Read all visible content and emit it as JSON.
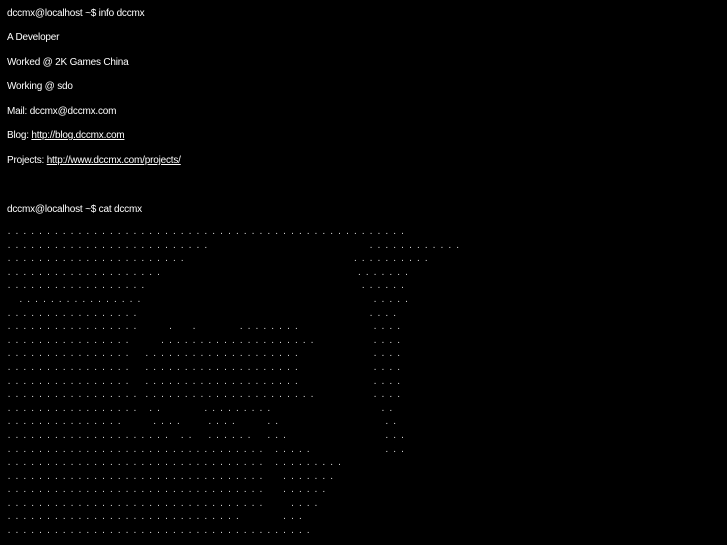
{
  "terminal": {
    "prompt1": "dccmx@localhost ~$ info dccmx",
    "info": {
      "role": "A Developer",
      "worked": "Worked @ 2K Games China",
      "working": "Working @ sdo",
      "mail": "Mail: dccmx@dccmx.com",
      "blog_label": "Blog: ",
      "blog_link": "http://blog.dccmx.com",
      "projects_label": "Projects: ",
      "projects_link": "http://www.dccmx.com/projects/"
    },
    "prompt2": "dccmx@localhost ~$ cat dccmx",
    "ascii_art": [
      ". . . . . . . . . . . . . . . . . . . . . . . . . . . . . . . . . . . . . . . . . . . . . . . . . . .",
      ". . . . . . . . . . . . . . . . . . . . . . . . . .                                         . . . . . . . . . . . .",
      ". . . . . . . . . . . . . . . . . . . . . . .                                           . . . . . . . . . .",
      ". . . . . . . . . . . . . . . . . . . .                                                  . . . . . . .",
      ". . . . . . . . . . . . . . . . . .                                                       . . . . . .",
      "   . . . . . . . . . . . . . . . .                                                           . . . . .",
      ". . . . . . . . . . . . . . . . .                                                           . . . .",
      ". . . . . . . . . . . . . . . . .        .     .           . . . . . . . .                   . . . .",
      ". . . . . . . . . . . . . . . .        . . . . . . . . . . . . . . . . . . . .               . . . .",
      ". . . . . . . . . . . . . . . .    . . . . . . . . . . . . . . . . . . . .                   . . . .",
      ". . . . . . . . . . . . . . . .    . . . . . . . . . . . . . . . . . . . .                   . . . .",
      ". . . . . . . . . . . . . . . .    . . . . . . . . . . . . . . . . . . . .                   . . . .",
      ". . . . . . . . . . . . . . . . .  . . . . . . . . . . . . . . . . . . . . . .               . . . .",
      ". . . . . . . . . . . . . . . . .   . .           . . . . . . . . .                            . .",
      ". . . . . . . . . . . . . . .        . . . .       . . . .        . .                           . .",
      ". . . . . . . . . . . . . . . . . . . . .   . .    . . . . . .    . . .                         . . .",
      ". . . . . . . . . . . . . . . . . . . . . . . . . . . . . . . . .   . . . . .                   . . .",
      ". . . . . . . . . . . . . . . . . . . . . . . . . . . . . . . . .   . . . . . . . . .",
      ". . . . . . . . . . . . . . . . . . . . . . . . . . . . . . . . .     . . . . . . .",
      ". . . . . . . . . . . . . . . . . . . . . . . . . . . . . . . . .     . . . . . .",
      ". . . . . . . . . . . . . . . . . . . . . . . . . . . . . . . . .       . . . .",
      ". . . . . . . . . . . . . . . . . . . . . . . . . . . . . .           . . .",
      ". . . . . . . . . . . . . . . . . . . . . . . . . . . . . . . . . . . . . . ."
    ]
  }
}
